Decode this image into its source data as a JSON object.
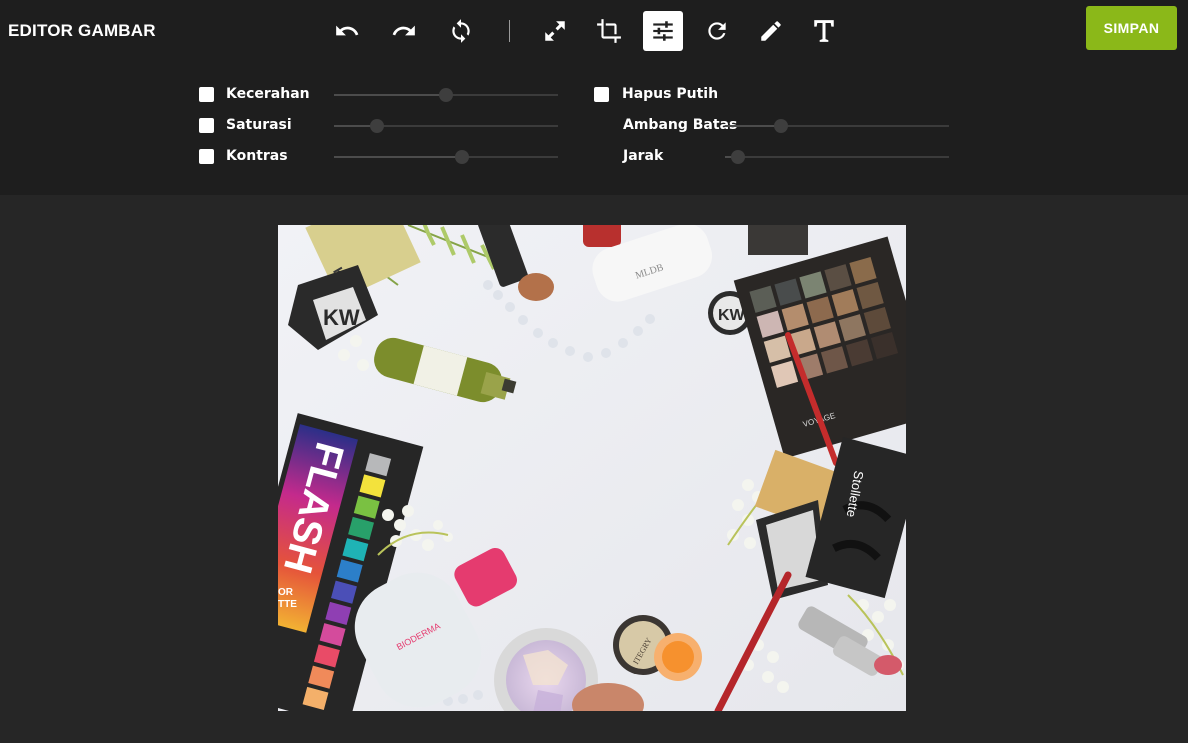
{
  "app": {
    "title": "EDITOR GAMBAR"
  },
  "toolbar": {
    "tools": [
      {
        "name": "undo",
        "icon": "undo-icon",
        "active": false
      },
      {
        "name": "redo",
        "icon": "redo-icon",
        "active": false
      },
      {
        "name": "reset",
        "icon": "reset-icon",
        "active": false
      },
      {
        "name": "resize",
        "icon": "resize-icon",
        "active": false
      },
      {
        "name": "crop",
        "icon": "crop-icon",
        "active": false
      },
      {
        "name": "adjust",
        "icon": "sliders-icon",
        "active": true
      },
      {
        "name": "rotate",
        "icon": "rotate-icon",
        "active": false
      },
      {
        "name": "draw",
        "icon": "pencil-icon",
        "active": false
      },
      {
        "name": "text",
        "icon": "text-icon",
        "active": false
      }
    ],
    "save_label": "SIMPAN"
  },
  "adjust": {
    "left": [
      {
        "label": "Kecerahan",
        "checked": false,
        "value": 0.5
      },
      {
        "label": "Saturasi",
        "checked": false,
        "value": 0.19
      },
      {
        "label": "Kontras",
        "checked": false,
        "value": 0.57
      }
    ],
    "right": {
      "remove_white": {
        "label": "Hapus Putih",
        "checked": false
      },
      "threshold": {
        "label": "Ambang Batas",
        "value": 0.25
      },
      "distance": {
        "label": "Jarak",
        "value": 0.06
      }
    }
  },
  "photo": {
    "subject": "cosmetics flat lay",
    "texts": {
      "palette_brand": "FLASH",
      "palette_sub_1": "OR",
      "palette_sub_2": "TTE",
      "lashes_brand": "Stollette",
      "micellar_brand": "BIODERMA",
      "kiko_1": "KW",
      "kiko_2": "KW",
      "kiko_3": "KW",
      "eyeshadow_brand": "VOYAGE",
      "powder_brand": "ITEGRY",
      "bottle_brand": "MLDB"
    }
  },
  "colors": {
    "topbar": "#1e1e1e",
    "background": "#262626",
    "accent": "#8bb819",
    "active_tool_bg": "#ffffff"
  }
}
